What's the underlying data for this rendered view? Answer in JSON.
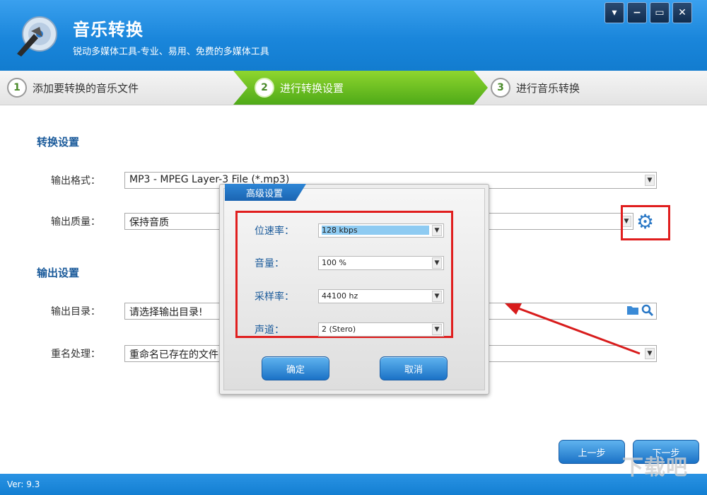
{
  "app": {
    "title": "音乐转换",
    "subtitle": "锐动多媒体工具-专业、易用、免费的多媒体工具",
    "version": "Ver: 9.3"
  },
  "window_buttons": {
    "menu": "▾",
    "minimize": "−",
    "maximize": "▭",
    "close": "✕"
  },
  "steps": [
    {
      "num": "1",
      "label": "添加要转换的音乐文件"
    },
    {
      "num": "2",
      "label": "进行转换设置"
    },
    {
      "num": "3",
      "label": "进行音乐转换"
    }
  ],
  "convert_settings": {
    "title": "转换设置",
    "format_label": "输出格式：",
    "format_value": "MP3 - MPEG Layer-3 File (*.mp3)",
    "quality_label": "输出质量：",
    "quality_value": "保持音质"
  },
  "output_settings": {
    "title": "输出设置",
    "dir_label": "输出目录：",
    "dir_value": "请选择输出目录!",
    "rename_label": "重名处理：",
    "rename_value": "重命名已存在的文件"
  },
  "dialog": {
    "title": "高级设置",
    "bitrate_label": "位速率：",
    "bitrate_value": "128 kbps",
    "volume_label": "音量：",
    "volume_value": "100 %",
    "samplerate_label": "采样率：",
    "samplerate_value": "44100 hz",
    "channel_label": "声道：",
    "channel_value": "2 (Stero)",
    "ok": "确定",
    "cancel": "取消"
  },
  "nav": {
    "prev": "上一步",
    "next": "下一步"
  },
  "watermark": "下载吧",
  "icons": [
    "app-logo-icon",
    "gear-icon",
    "folder-icon",
    "search-icon",
    "dropdown-arrow-icon"
  ],
  "colors": {
    "header": "#1a86db",
    "active_step": "#5cb21e",
    "highlight": "#e01e1e",
    "section_title": "#1a5a9a"
  }
}
